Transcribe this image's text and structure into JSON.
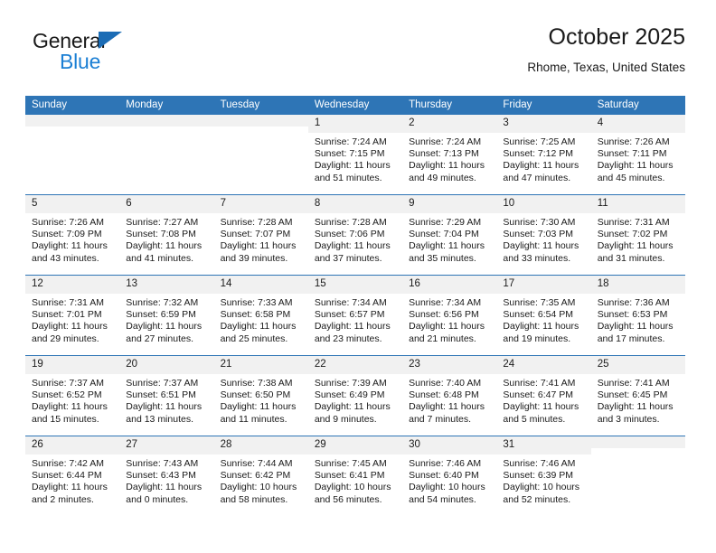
{
  "brand": {
    "name_part1": "General",
    "name_part2": "Blue",
    "triangle_color": "#1b6cb5",
    "blue_color": "#1b7fd4"
  },
  "header": {
    "title": "October 2025",
    "location": "Rhome, Texas, United States"
  },
  "theme": {
    "header_bg": "#2e75b6",
    "daynum_bg": "#f1f1f1",
    "text": "#1a1a1a"
  },
  "weekday_headers": [
    "Sunday",
    "Monday",
    "Tuesday",
    "Wednesday",
    "Thursday",
    "Friday",
    "Saturday"
  ],
  "labels": {
    "sunrise": "Sunrise:",
    "sunset": "Sunset:",
    "daylight": "Daylight:"
  },
  "weeks": [
    [
      {
        "day": "",
        "sunrise": "",
        "sunset": "",
        "daylight": ""
      },
      {
        "day": "",
        "sunrise": "",
        "sunset": "",
        "daylight": ""
      },
      {
        "day": "",
        "sunrise": "",
        "sunset": "",
        "daylight": ""
      },
      {
        "day": "1",
        "sunrise": "Sunrise: 7:24 AM",
        "sunset": "Sunset: 7:15 PM",
        "daylight": "Daylight: 11 hours and 51 minutes."
      },
      {
        "day": "2",
        "sunrise": "Sunrise: 7:24 AM",
        "sunset": "Sunset: 7:13 PM",
        "daylight": "Daylight: 11 hours and 49 minutes."
      },
      {
        "day": "3",
        "sunrise": "Sunrise: 7:25 AM",
        "sunset": "Sunset: 7:12 PM",
        "daylight": "Daylight: 11 hours and 47 minutes."
      },
      {
        "day": "4",
        "sunrise": "Sunrise: 7:26 AM",
        "sunset": "Sunset: 7:11 PM",
        "daylight": "Daylight: 11 hours and 45 minutes."
      }
    ],
    [
      {
        "day": "5",
        "sunrise": "Sunrise: 7:26 AM",
        "sunset": "Sunset: 7:09 PM",
        "daylight": "Daylight: 11 hours and 43 minutes."
      },
      {
        "day": "6",
        "sunrise": "Sunrise: 7:27 AM",
        "sunset": "Sunset: 7:08 PM",
        "daylight": "Daylight: 11 hours and 41 minutes."
      },
      {
        "day": "7",
        "sunrise": "Sunrise: 7:28 AM",
        "sunset": "Sunset: 7:07 PM",
        "daylight": "Daylight: 11 hours and 39 minutes."
      },
      {
        "day": "8",
        "sunrise": "Sunrise: 7:28 AM",
        "sunset": "Sunset: 7:06 PM",
        "daylight": "Daylight: 11 hours and 37 minutes."
      },
      {
        "day": "9",
        "sunrise": "Sunrise: 7:29 AM",
        "sunset": "Sunset: 7:04 PM",
        "daylight": "Daylight: 11 hours and 35 minutes."
      },
      {
        "day": "10",
        "sunrise": "Sunrise: 7:30 AM",
        "sunset": "Sunset: 7:03 PM",
        "daylight": "Daylight: 11 hours and 33 minutes."
      },
      {
        "day": "11",
        "sunrise": "Sunrise: 7:31 AM",
        "sunset": "Sunset: 7:02 PM",
        "daylight": "Daylight: 11 hours and 31 minutes."
      }
    ],
    [
      {
        "day": "12",
        "sunrise": "Sunrise: 7:31 AM",
        "sunset": "Sunset: 7:01 PM",
        "daylight": "Daylight: 11 hours and 29 minutes."
      },
      {
        "day": "13",
        "sunrise": "Sunrise: 7:32 AM",
        "sunset": "Sunset: 6:59 PM",
        "daylight": "Daylight: 11 hours and 27 minutes."
      },
      {
        "day": "14",
        "sunrise": "Sunrise: 7:33 AM",
        "sunset": "Sunset: 6:58 PM",
        "daylight": "Daylight: 11 hours and 25 minutes."
      },
      {
        "day": "15",
        "sunrise": "Sunrise: 7:34 AM",
        "sunset": "Sunset: 6:57 PM",
        "daylight": "Daylight: 11 hours and 23 minutes."
      },
      {
        "day": "16",
        "sunrise": "Sunrise: 7:34 AM",
        "sunset": "Sunset: 6:56 PM",
        "daylight": "Daylight: 11 hours and 21 minutes."
      },
      {
        "day": "17",
        "sunrise": "Sunrise: 7:35 AM",
        "sunset": "Sunset: 6:54 PM",
        "daylight": "Daylight: 11 hours and 19 minutes."
      },
      {
        "day": "18",
        "sunrise": "Sunrise: 7:36 AM",
        "sunset": "Sunset: 6:53 PM",
        "daylight": "Daylight: 11 hours and 17 minutes."
      }
    ],
    [
      {
        "day": "19",
        "sunrise": "Sunrise: 7:37 AM",
        "sunset": "Sunset: 6:52 PM",
        "daylight": "Daylight: 11 hours and 15 minutes."
      },
      {
        "day": "20",
        "sunrise": "Sunrise: 7:37 AM",
        "sunset": "Sunset: 6:51 PM",
        "daylight": "Daylight: 11 hours and 13 minutes."
      },
      {
        "day": "21",
        "sunrise": "Sunrise: 7:38 AM",
        "sunset": "Sunset: 6:50 PM",
        "daylight": "Daylight: 11 hours and 11 minutes."
      },
      {
        "day": "22",
        "sunrise": "Sunrise: 7:39 AM",
        "sunset": "Sunset: 6:49 PM",
        "daylight": "Daylight: 11 hours and 9 minutes."
      },
      {
        "day": "23",
        "sunrise": "Sunrise: 7:40 AM",
        "sunset": "Sunset: 6:48 PM",
        "daylight": "Daylight: 11 hours and 7 minutes."
      },
      {
        "day": "24",
        "sunrise": "Sunrise: 7:41 AM",
        "sunset": "Sunset: 6:47 PM",
        "daylight": "Daylight: 11 hours and 5 minutes."
      },
      {
        "day": "25",
        "sunrise": "Sunrise: 7:41 AM",
        "sunset": "Sunset: 6:45 PM",
        "daylight": "Daylight: 11 hours and 3 minutes."
      }
    ],
    [
      {
        "day": "26",
        "sunrise": "Sunrise: 7:42 AM",
        "sunset": "Sunset: 6:44 PM",
        "daylight": "Daylight: 11 hours and 2 minutes."
      },
      {
        "day": "27",
        "sunrise": "Sunrise: 7:43 AM",
        "sunset": "Sunset: 6:43 PM",
        "daylight": "Daylight: 11 hours and 0 minutes."
      },
      {
        "day": "28",
        "sunrise": "Sunrise: 7:44 AM",
        "sunset": "Sunset: 6:42 PM",
        "daylight": "Daylight: 10 hours and 58 minutes."
      },
      {
        "day": "29",
        "sunrise": "Sunrise: 7:45 AM",
        "sunset": "Sunset: 6:41 PM",
        "daylight": "Daylight: 10 hours and 56 minutes."
      },
      {
        "day": "30",
        "sunrise": "Sunrise: 7:46 AM",
        "sunset": "Sunset: 6:40 PM",
        "daylight": "Daylight: 10 hours and 54 minutes."
      },
      {
        "day": "31",
        "sunrise": "Sunrise: 7:46 AM",
        "sunset": "Sunset: 6:39 PM",
        "daylight": "Daylight: 10 hours and 52 minutes."
      },
      {
        "day": "",
        "sunrise": "",
        "sunset": "",
        "daylight": ""
      }
    ]
  ]
}
